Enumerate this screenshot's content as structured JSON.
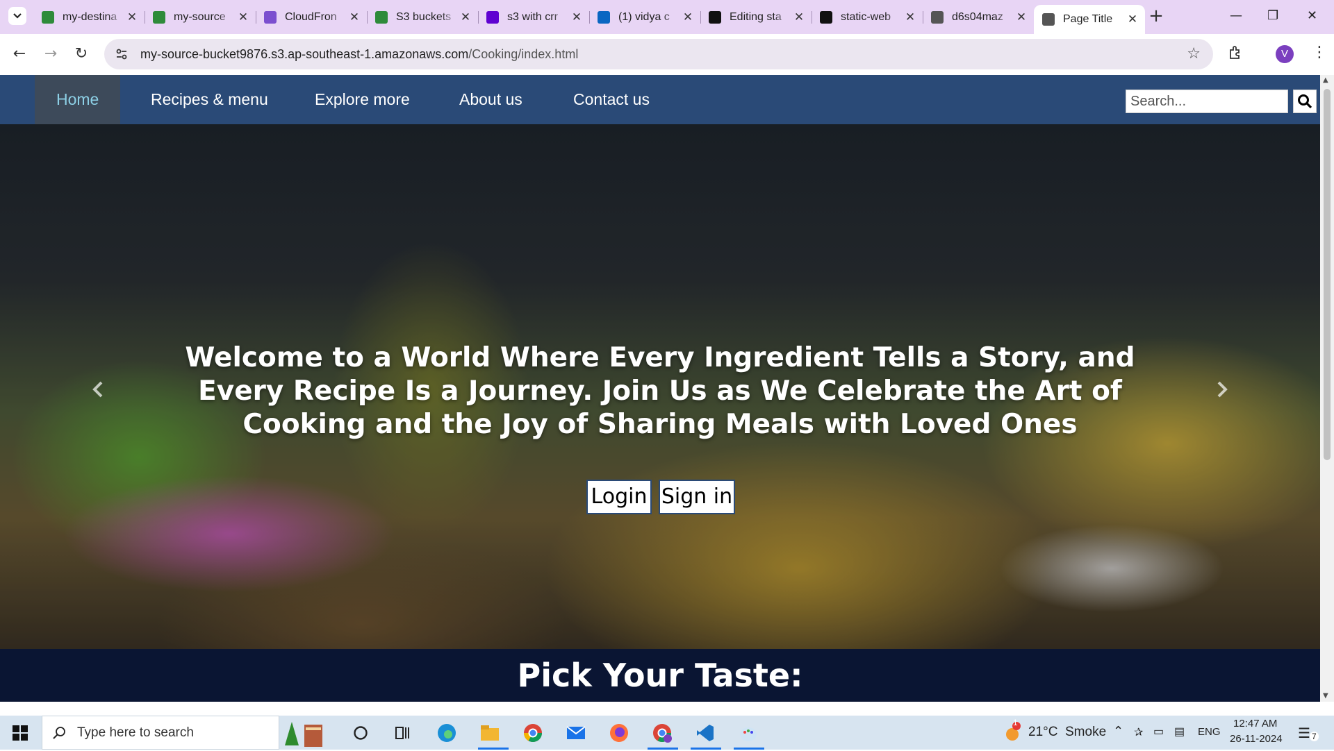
{
  "browser": {
    "tabs": [
      {
        "title": "my-destina",
        "favicon": "s3-icon",
        "color": "#2e8b3a"
      },
      {
        "title": "my-source",
        "favicon": "s3-icon",
        "color": "#2e8b3a"
      },
      {
        "title": "CloudFron",
        "favicon": "cloudfront-icon",
        "color": "#7b4fcf"
      },
      {
        "title": "S3 buckets",
        "favicon": "s3-icon",
        "color": "#2e8b3a"
      },
      {
        "title": "s3 with crr",
        "favicon": "yahoo-icon",
        "color": "#5f01d1"
      },
      {
        "title": "(1) vidya c",
        "favicon": "linkedin-icon",
        "color": "#0a66c2"
      },
      {
        "title": "Editing sta",
        "favicon": "github-icon",
        "color": "#111111"
      },
      {
        "title": "static-web",
        "favicon": "github-icon",
        "color": "#111111"
      },
      {
        "title": "d6s04maz",
        "favicon": "globe-icon",
        "color": "#555555"
      },
      {
        "title": "Page Title",
        "favicon": "globe-icon",
        "color": "#555555",
        "active": true
      }
    ],
    "address": {
      "host": "my-source-bucket9876.s3.ap-southeast-1.amazonaws.com",
      "path": "/Cooking/index.html"
    },
    "profile_initial": "V"
  },
  "site": {
    "nav": [
      {
        "label": "Home",
        "active": true
      },
      {
        "label": "Recipes & menu"
      },
      {
        "label": "Explore more"
      },
      {
        "label": "About us"
      },
      {
        "label": "Contact us"
      }
    ],
    "search_placeholder": "Search...",
    "hero": {
      "headline": "Welcome to a World Where Every Ingredient Tells a Story, and Every Recipe Is a Journey. Join Us as We Celebrate the Art of Cooking and the Joy of Sharing Meals with Loved Ones",
      "login_label": "Login",
      "signin_label": "Sign in",
      "slides": 3,
      "active_slide": 1
    },
    "section_title": "Pick Your Taste:",
    "colors": {
      "nav_bg": "#2a4a77",
      "nav_active_text": "#8dd0e6",
      "page_bg": "#0a1533"
    }
  },
  "taskbar": {
    "search_placeholder": "Type here to search",
    "weather": "21°C  Smoke",
    "weather_badge": "1",
    "lang": "ENG",
    "time": "12:47 AM",
    "date": "26-11-2024",
    "notifications": "7"
  }
}
